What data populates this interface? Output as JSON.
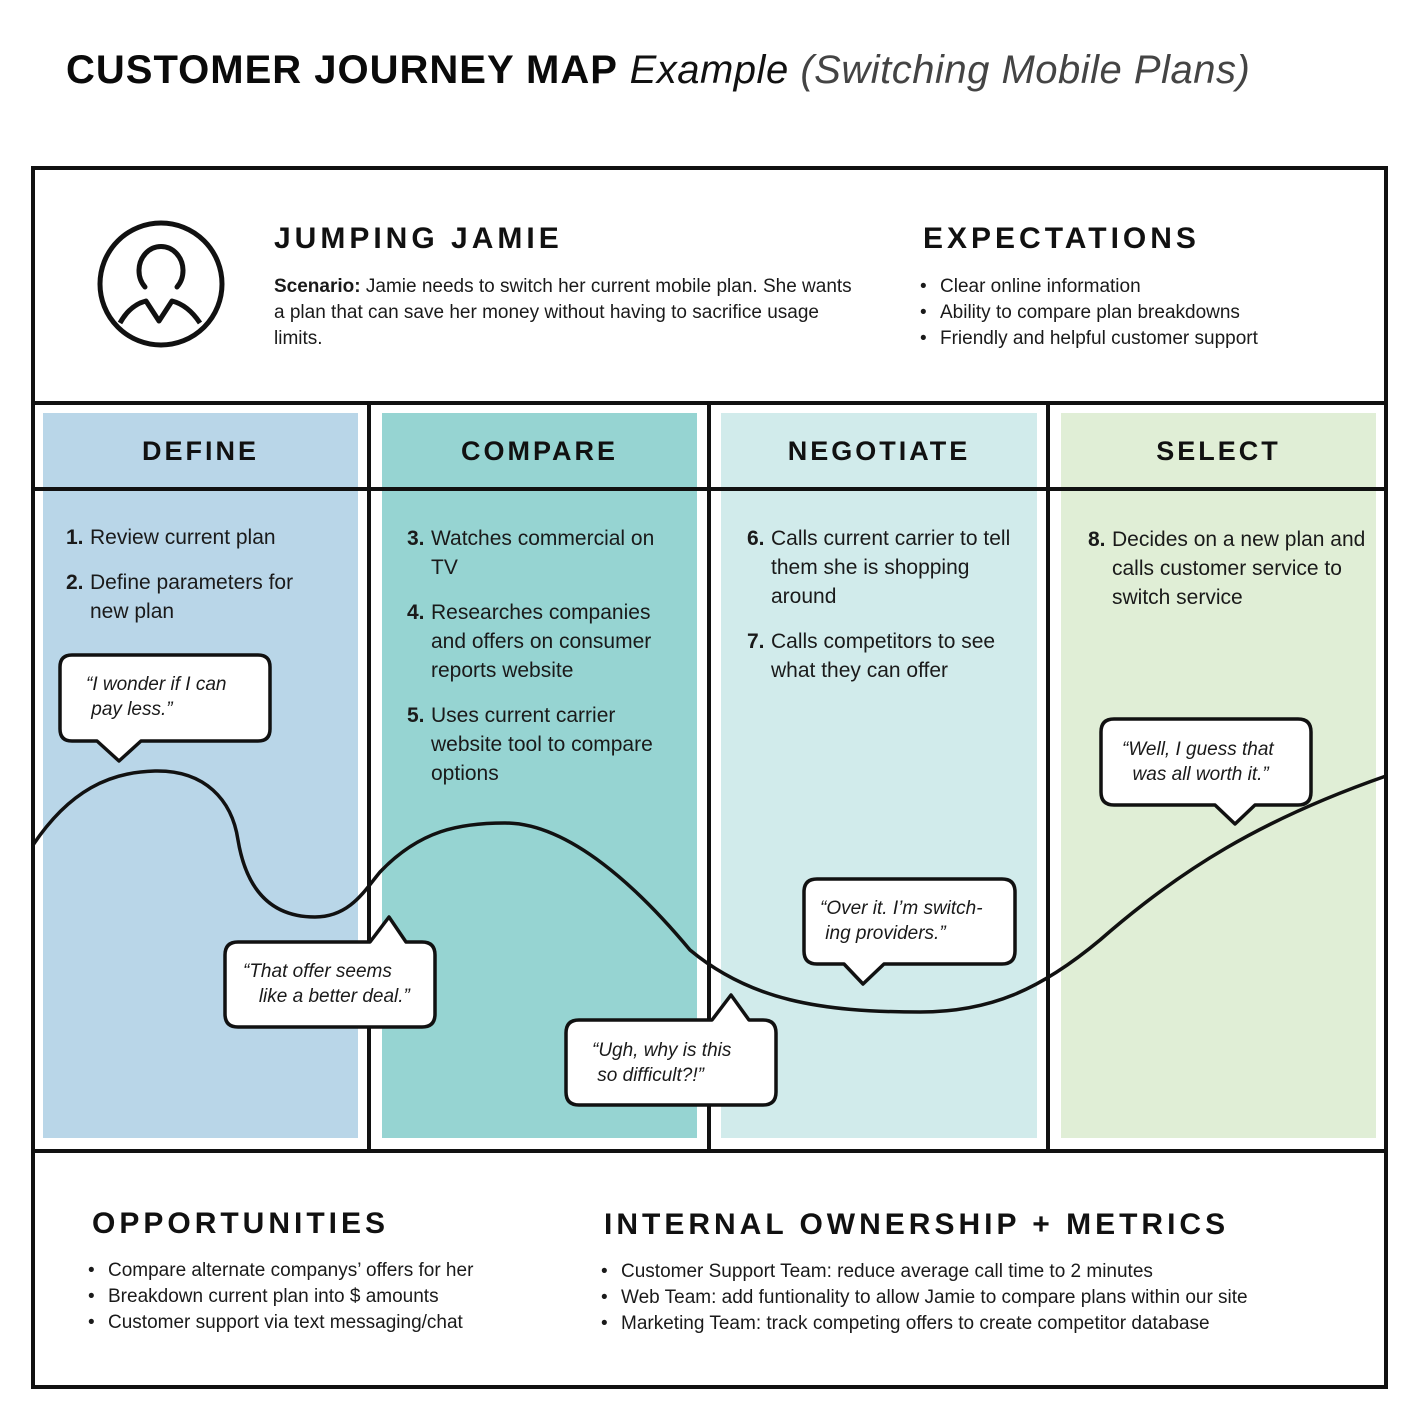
{
  "header": {
    "title_main": "CUSTOMER JOURNEY MAP",
    "title_example": "Example",
    "title_subtitle": "(Switching Mobile Plans)"
  },
  "persona": {
    "icon": "user-avatar-icon",
    "name": "JUMPING JAMIE",
    "scenario_label": "Scenario:",
    "scenario_text": "Jamie needs to switch her current mobile plan. She wants a plan that can save her money without having to sacrifice usage limits."
  },
  "expectations": {
    "title": "EXPECTATIONS",
    "items": [
      "Clear online information",
      "Ability to compare plan breakdowns",
      "Friendly and helpful customer support"
    ]
  },
  "stages": [
    {
      "title": "DEFINE",
      "color": "#b9d6e8",
      "steps": [
        {
          "num": "1.",
          "text": "Review current plan"
        },
        {
          "num": "2.",
          "text": "Define parameters for new plan"
        }
      ]
    },
    {
      "title": "COMPARE",
      "color": "#96d4d2",
      "steps": [
        {
          "num": "3.",
          "text": "Watches commercial on TV"
        },
        {
          "num": "4.",
          "text": "Researches companies and offers on consumer reports website"
        },
        {
          "num": "5.",
          "text": "Uses current carrier website tool to compare options"
        }
      ]
    },
    {
      "title": "NEGOTIATE",
      "color": "#d1ebeb",
      "steps": [
        {
          "num": "6.",
          "text": "Calls current carrier to tell them she is shopping around"
        },
        {
          "num": "7.",
          "text": "Calls competitors to see what they can offer"
        }
      ]
    },
    {
      "title": "SELECT",
      "color": "#e0eed6",
      "steps": [
        {
          "num": "8.",
          "text": "Decides on a new plan and calls customer service to switch service"
        }
      ]
    }
  ],
  "emotions": [
    {
      "stage": "DEFINE",
      "quote": "“I wonder if I can\n pay less.”",
      "sentiment": "high"
    },
    {
      "stage": "DEFINE",
      "quote": "“That offer seems\n   like a better deal.”",
      "sentiment": "low"
    },
    {
      "stage": "COMPARE",
      "quote": "“Ugh, why is this\n so difficult?!”",
      "sentiment": "low"
    },
    {
      "stage": "NEGOTIATE",
      "quote": "“Over it. I’m switch-\n ing providers.”",
      "sentiment": "lowest"
    },
    {
      "stage": "SELECT",
      "quote": "“Well, I guess that\n  was all worth it.”",
      "sentiment": "rising"
    }
  ],
  "opportunities": {
    "title": "OPPORTUNITIES",
    "items": [
      "Compare alternate companys’ offers for her",
      "Breakdown current plan into $ amounts",
      "Customer support via text messaging/chat"
    ]
  },
  "metrics": {
    "title": "INTERNAL OWNERSHIP + METRICS",
    "items": [
      "Customer Support Team: reduce average call time to 2 minutes",
      "Web Team: add funtionality to allow Jamie to compare plans within our site",
      "Marketing Team: track competing offers to create competitor database"
    ]
  }
}
